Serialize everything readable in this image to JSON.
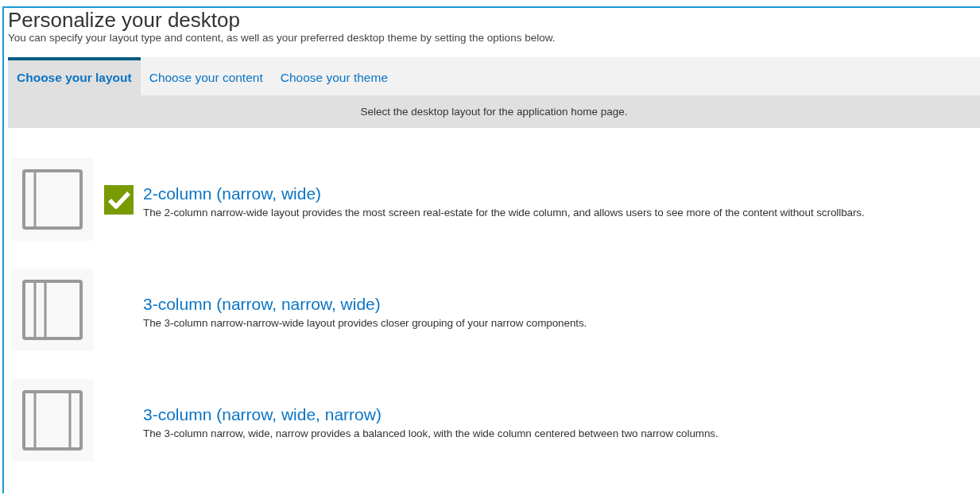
{
  "page": {
    "title": "Personalize your desktop",
    "subtitle": "You can specify your layout type and content, as well as your preferred desktop theme by setting the options below."
  },
  "tabs": [
    {
      "label": "Choose your layout",
      "selected": true
    },
    {
      "label": "Choose your content",
      "selected": false
    },
    {
      "label": "Choose your theme",
      "selected": false
    }
  ],
  "instruction": "Select the desktop layout for the application home page.",
  "layouts": [
    {
      "kind": "narrow-wide",
      "title": "2-column (narrow, wide)",
      "description": "The 2-column narrow-wide layout provides the most screen real-estate for the wide column, and allows users to see more of the content without scrollbars.",
      "selected": true
    },
    {
      "kind": "narrow-narrow-wide",
      "title": "3-column (narrow, narrow, wide)",
      "description": "The 3-column narrow-narrow-wide layout provides closer grouping of your narrow components.",
      "selected": false
    },
    {
      "kind": "narrow-wide-narrow",
      "title": "3-column (narrow, wide, narrow)",
      "description": "The 3-column narrow, wide, narrow provides a balanced look, with the wide column centered between two narrow columns.",
      "selected": false
    }
  ]
}
